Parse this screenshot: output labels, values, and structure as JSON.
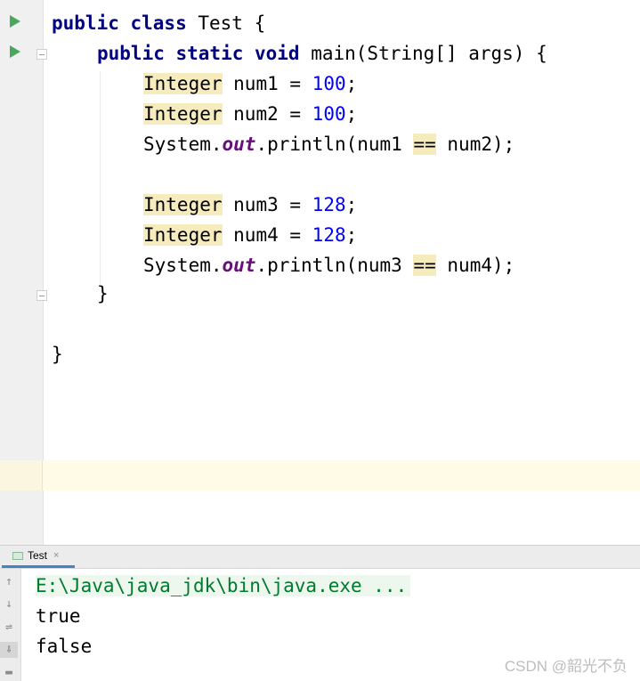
{
  "editor": {
    "lines": [
      {
        "kw": "public class",
        "rest": " Test {"
      },
      {
        "kw": "public static void",
        "rest": " main(String[] args) {"
      },
      {
        "type": "Integer",
        "decl": " num1 = ",
        "num": "100",
        "end": ";"
      },
      {
        "type": "Integer",
        "decl": " num2 = ",
        "num": "100",
        "end": ";"
      },
      {
        "pre": "System.",
        "out": "out",
        "mid": ".println(num1 ",
        "op": "==",
        "post": " num2);"
      },
      {
        "type": "Integer",
        "decl": " num3 = ",
        "num": "128",
        "end": ";"
      },
      {
        "type": "Integer",
        "decl": " num4 = ",
        "num": "128",
        "end": ";"
      },
      {
        "pre": "System.",
        "out": "out",
        "mid": ".println(num3 ",
        "op": "==",
        "post": " num4);"
      },
      {
        "text": "}"
      },
      {
        "text": "}"
      }
    ]
  },
  "run_panel": {
    "tab_label": "Test",
    "close_glyph": "×",
    "command": "E:\\Java\\java_jdk\\bin\\java.exe ...",
    "output": [
      "true",
      "false"
    ]
  },
  "watermark": "CSDN @韶光不负",
  "icons": {
    "run": "run-icon",
    "fold": "fold-icon",
    "sidebar": [
      "up-arrow-icon",
      "down-arrow-icon",
      "soft-wrap-icon",
      "scroll-to-end-icon",
      "print-icon"
    ]
  },
  "colors": {
    "keyword": "#000080",
    "number": "#0000ff",
    "static_field": "#660e7a",
    "highlight": "#f6ebbc",
    "command": "#007a2c"
  }
}
